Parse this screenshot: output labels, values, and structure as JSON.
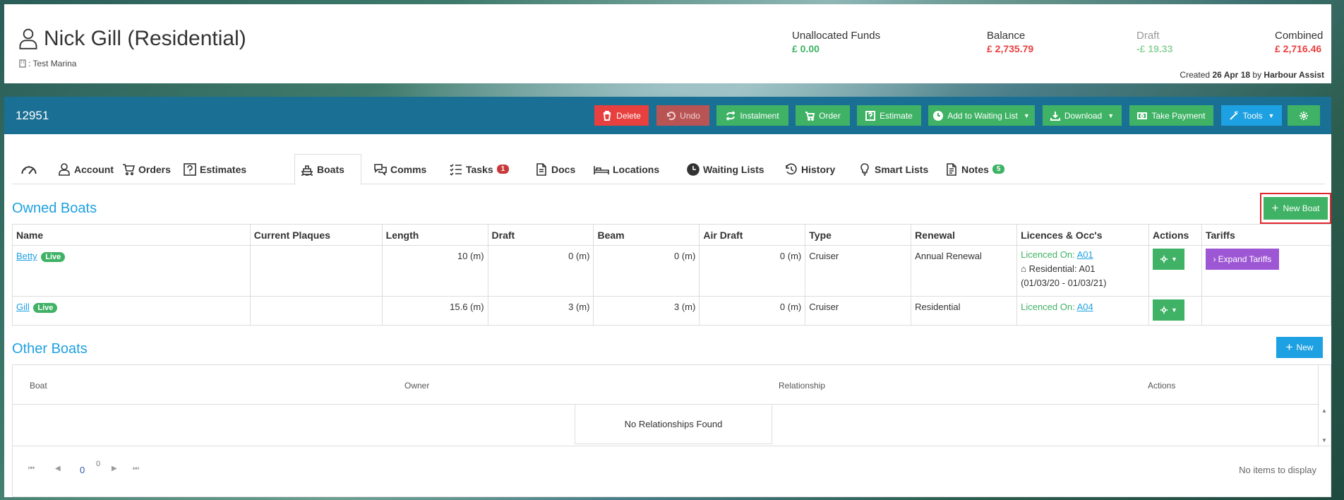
{
  "customer": {
    "name": "Nick Gill (Residential)",
    "marina": ": Test Marina"
  },
  "funds": [
    {
      "label": "Unallocated Funds",
      "value": "£ 0.00",
      "label_color": "#333333",
      "value_color": "#3fb265"
    },
    {
      "label": "Balance",
      "value": "£ 2,735.79",
      "label_color": "#333333",
      "value_color": "#e8403f"
    },
    {
      "label": "Draft",
      "value": "-£ 19.33",
      "label_color": "#999999",
      "value_color": "#8fd39e"
    },
    {
      "label": "Combined",
      "value": "£ 2,716.46",
      "label_color": "#333333",
      "value_color": "#e8403f"
    }
  ],
  "created": {
    "prefix": "Created",
    "date": "26 Apr 18",
    "by": "by",
    "author": "Harbour Assist"
  },
  "toolbar": {
    "account_number": "12951",
    "delete": "Delete",
    "undo": "Undo",
    "instalment": "Instalment",
    "order": "Order",
    "estimate": "Estimate",
    "waiting_list": "Add to Waiting List",
    "download": "Download",
    "take_payment": "Take Payment",
    "tools": "Tools"
  },
  "tabs": [
    {
      "label": ""
    },
    {
      "label": "Account"
    },
    {
      "label": "Orders"
    },
    {
      "label": "Estimates"
    },
    {
      "label": "Boats"
    },
    {
      "label": "Comms"
    },
    {
      "label": "Tasks",
      "badge": "1"
    },
    {
      "label": "Docs"
    },
    {
      "label": "Locations"
    },
    {
      "label": "Waiting Lists"
    },
    {
      "label": "History"
    },
    {
      "label": "Smart Lists"
    },
    {
      "label": "Notes",
      "badge": "5"
    }
  ],
  "owned_boats": {
    "title": "Owned Boats",
    "new_button": "New Boat",
    "columns": [
      "Name",
      "Current Plaques",
      "Length",
      "Draft",
      "Beam",
      "Air Draft",
      "Type",
      "Renewal",
      "Licences & Occ's",
      "Actions",
      "Tariffs"
    ],
    "rows": [
      {
        "name": "Betty",
        "status": "Live",
        "plaques": "",
        "length": "10 (m)",
        "draft": "0 (m)",
        "beam": "0 (m)",
        "air_draft": "0 (m)",
        "type": "Cruiser",
        "renewal": "Annual Renewal",
        "licence_prefix": "Licenced On:",
        "licence_link": "A01",
        "residential": "Residential: A01",
        "residential_dates": "(01/03/20 - 01/03/21)",
        "tariff_button": "Expand Tariffs"
      },
      {
        "name": "Gill",
        "status": "Live",
        "plaques": "",
        "length": "15.6 (m)",
        "draft": "3 (m)",
        "beam": "3 (m)",
        "air_draft": "0 (m)",
        "type": "Cruiser",
        "renewal": "Residential",
        "licence_prefix": "Licenced On:",
        "licence_link": "A04"
      }
    ]
  },
  "other_boats": {
    "title": "Other Boats",
    "new_button": "New",
    "columns": [
      "Boat",
      "Owner",
      "Relationship",
      "Actions"
    ],
    "empty_message": "No Relationships Found",
    "pager": {
      "page": "0",
      "total": "0",
      "status": "No items to display"
    }
  }
}
